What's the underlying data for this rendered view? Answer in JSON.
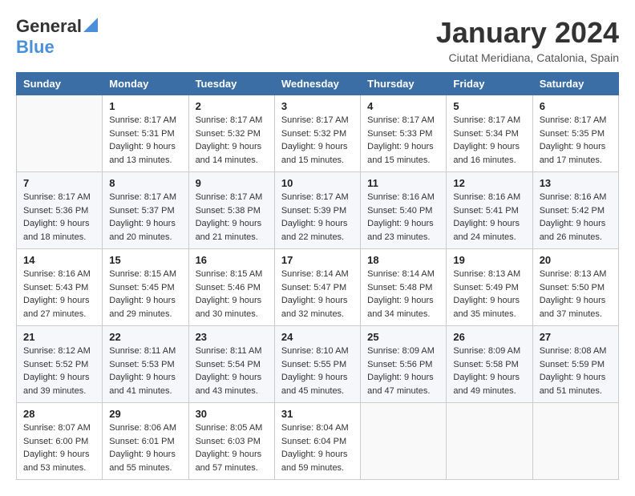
{
  "header": {
    "logo_general": "General",
    "logo_blue": "Blue",
    "month_title": "January 2024",
    "location": "Ciutat Meridiana, Catalonia, Spain"
  },
  "days_of_week": [
    "Sunday",
    "Monday",
    "Tuesday",
    "Wednesday",
    "Thursday",
    "Friday",
    "Saturday"
  ],
  "weeks": [
    {
      "cells": [
        {
          "day": "",
          "info": ""
        },
        {
          "day": "1",
          "info": "Sunrise: 8:17 AM\nSunset: 5:31 PM\nDaylight: 9 hours\nand 13 minutes."
        },
        {
          "day": "2",
          "info": "Sunrise: 8:17 AM\nSunset: 5:32 PM\nDaylight: 9 hours\nand 14 minutes."
        },
        {
          "day": "3",
          "info": "Sunrise: 8:17 AM\nSunset: 5:32 PM\nDaylight: 9 hours\nand 15 minutes."
        },
        {
          "day": "4",
          "info": "Sunrise: 8:17 AM\nSunset: 5:33 PM\nDaylight: 9 hours\nand 15 minutes."
        },
        {
          "day": "5",
          "info": "Sunrise: 8:17 AM\nSunset: 5:34 PM\nDaylight: 9 hours\nand 16 minutes."
        },
        {
          "day": "6",
          "info": "Sunrise: 8:17 AM\nSunset: 5:35 PM\nDaylight: 9 hours\nand 17 minutes."
        }
      ]
    },
    {
      "cells": [
        {
          "day": "7",
          "info": "Sunrise: 8:17 AM\nSunset: 5:36 PM\nDaylight: 9 hours\nand 18 minutes."
        },
        {
          "day": "8",
          "info": "Sunrise: 8:17 AM\nSunset: 5:37 PM\nDaylight: 9 hours\nand 20 minutes."
        },
        {
          "day": "9",
          "info": "Sunrise: 8:17 AM\nSunset: 5:38 PM\nDaylight: 9 hours\nand 21 minutes."
        },
        {
          "day": "10",
          "info": "Sunrise: 8:17 AM\nSunset: 5:39 PM\nDaylight: 9 hours\nand 22 minutes."
        },
        {
          "day": "11",
          "info": "Sunrise: 8:16 AM\nSunset: 5:40 PM\nDaylight: 9 hours\nand 23 minutes."
        },
        {
          "day": "12",
          "info": "Sunrise: 8:16 AM\nSunset: 5:41 PM\nDaylight: 9 hours\nand 24 minutes."
        },
        {
          "day": "13",
          "info": "Sunrise: 8:16 AM\nSunset: 5:42 PM\nDaylight: 9 hours\nand 26 minutes."
        }
      ]
    },
    {
      "cells": [
        {
          "day": "14",
          "info": "Sunrise: 8:16 AM\nSunset: 5:43 PM\nDaylight: 9 hours\nand 27 minutes."
        },
        {
          "day": "15",
          "info": "Sunrise: 8:15 AM\nSunset: 5:45 PM\nDaylight: 9 hours\nand 29 minutes."
        },
        {
          "day": "16",
          "info": "Sunrise: 8:15 AM\nSunset: 5:46 PM\nDaylight: 9 hours\nand 30 minutes."
        },
        {
          "day": "17",
          "info": "Sunrise: 8:14 AM\nSunset: 5:47 PM\nDaylight: 9 hours\nand 32 minutes."
        },
        {
          "day": "18",
          "info": "Sunrise: 8:14 AM\nSunset: 5:48 PM\nDaylight: 9 hours\nand 34 minutes."
        },
        {
          "day": "19",
          "info": "Sunrise: 8:13 AM\nSunset: 5:49 PM\nDaylight: 9 hours\nand 35 minutes."
        },
        {
          "day": "20",
          "info": "Sunrise: 8:13 AM\nSunset: 5:50 PM\nDaylight: 9 hours\nand 37 minutes."
        }
      ]
    },
    {
      "cells": [
        {
          "day": "21",
          "info": "Sunrise: 8:12 AM\nSunset: 5:52 PM\nDaylight: 9 hours\nand 39 minutes."
        },
        {
          "day": "22",
          "info": "Sunrise: 8:11 AM\nSunset: 5:53 PM\nDaylight: 9 hours\nand 41 minutes."
        },
        {
          "day": "23",
          "info": "Sunrise: 8:11 AM\nSunset: 5:54 PM\nDaylight: 9 hours\nand 43 minutes."
        },
        {
          "day": "24",
          "info": "Sunrise: 8:10 AM\nSunset: 5:55 PM\nDaylight: 9 hours\nand 45 minutes."
        },
        {
          "day": "25",
          "info": "Sunrise: 8:09 AM\nSunset: 5:56 PM\nDaylight: 9 hours\nand 47 minutes."
        },
        {
          "day": "26",
          "info": "Sunrise: 8:09 AM\nSunset: 5:58 PM\nDaylight: 9 hours\nand 49 minutes."
        },
        {
          "day": "27",
          "info": "Sunrise: 8:08 AM\nSunset: 5:59 PM\nDaylight: 9 hours\nand 51 minutes."
        }
      ]
    },
    {
      "cells": [
        {
          "day": "28",
          "info": "Sunrise: 8:07 AM\nSunset: 6:00 PM\nDaylight: 9 hours\nand 53 minutes."
        },
        {
          "day": "29",
          "info": "Sunrise: 8:06 AM\nSunset: 6:01 PM\nDaylight: 9 hours\nand 55 minutes."
        },
        {
          "day": "30",
          "info": "Sunrise: 8:05 AM\nSunset: 6:03 PM\nDaylight: 9 hours\nand 57 minutes."
        },
        {
          "day": "31",
          "info": "Sunrise: 8:04 AM\nSunset: 6:04 PM\nDaylight: 9 hours\nand 59 minutes."
        },
        {
          "day": "",
          "info": ""
        },
        {
          "day": "",
          "info": ""
        },
        {
          "day": "",
          "info": ""
        }
      ]
    }
  ]
}
